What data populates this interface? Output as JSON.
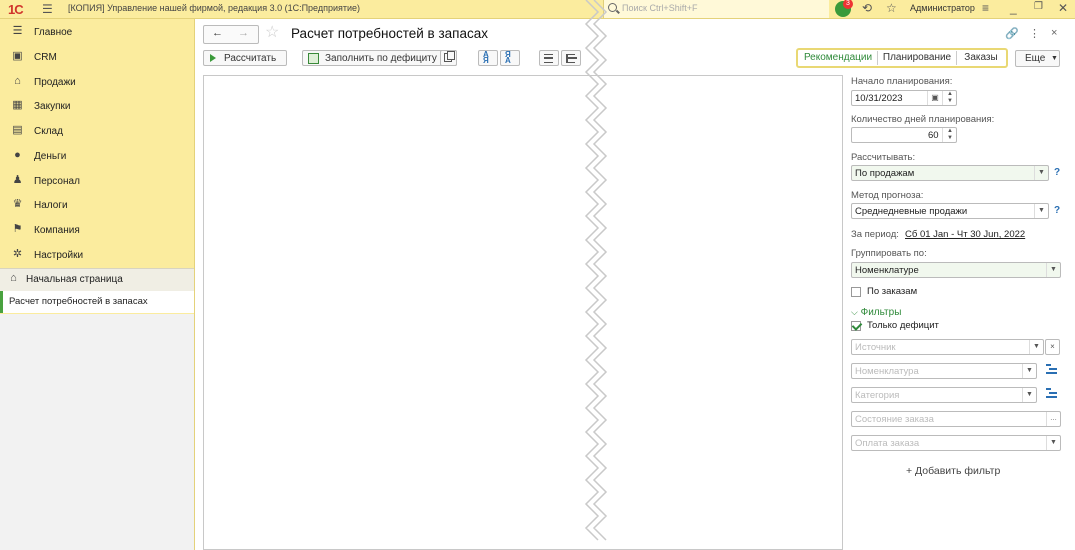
{
  "topbar": {
    "logo": "1С",
    "title": "[КОПИЯ] Управление нашей фирмой, редакция 3.0  (1С:Предприятие)",
    "search_placeholder": "Поиск Ctrl+Shift+F",
    "notifications": "3",
    "user": "Администратор"
  },
  "sidebar": {
    "items": [
      {
        "label": "Главное",
        "icon": "menu-icon"
      },
      {
        "label": "CRM",
        "icon": "crm-icon"
      },
      {
        "label": "Продажи",
        "icon": "sales-icon"
      },
      {
        "label": "Закупки",
        "icon": "purchases-icon"
      },
      {
        "label": "Склад",
        "icon": "warehouse-icon"
      },
      {
        "label": "Деньги",
        "icon": "money-icon"
      },
      {
        "label": "Персонал",
        "icon": "staff-icon"
      },
      {
        "label": "Налоги",
        "icon": "taxes-icon"
      },
      {
        "label": "Компания",
        "icon": "company-icon"
      },
      {
        "label": "Настройки",
        "icon": "gear-icon"
      }
    ],
    "home": "Начальная страница",
    "open_tab": "Расчет потребностей в запасах"
  },
  "page": {
    "title": "Расчет потребностей в запасах"
  },
  "toolbar": {
    "calculate": "Рассчитать",
    "fill_deficit": "Заполнить по дефициту",
    "segments": [
      "Рекомендации",
      "Планирование",
      "Заказы"
    ],
    "more": "Еще"
  },
  "panel": {
    "start_label": "Начало планирования:",
    "start_value": "10/31/2023",
    "days_label": "Количество дней планирования:",
    "days_value": "60",
    "calc_label": "Рассчитывать:",
    "calc_value": "По продажам",
    "method_label": "Метод прогноза:",
    "method_value": "Среднедневные продажи",
    "period_label": "За период:",
    "period_value": "Сб 01 Jan - Чт 30 Jun, 2022",
    "group_label": "Группировать по:",
    "group_value": "Номенклатуре",
    "by_orders": "По заказам",
    "filters_header": "Фильтры",
    "only_deficit": "Только дефицит",
    "source_ph": "Источник",
    "nomenclature_ph": "Номенклатура",
    "category_ph": "Категория",
    "order_state_ph": "Состояние заказа",
    "order_payment_ph": "Оплата заказа",
    "add_filter": "+ Добавить фильтр"
  }
}
